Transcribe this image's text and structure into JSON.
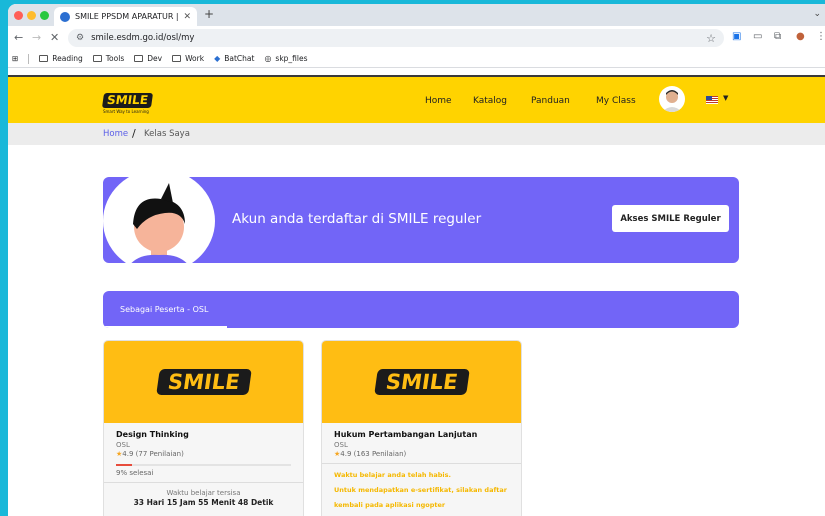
{
  "browser": {
    "tab_title": "SMILE PPSDM APARATUR | M",
    "url": "smile.esdm.go.id/osl/my",
    "bookmarks": [
      "Reading",
      "Tools",
      "Dev",
      "Work",
      "BatChat",
      "skp_files"
    ]
  },
  "header": {
    "logo_text": "SMILE",
    "logo_tagline": "Smart Way to Learning",
    "menu": [
      "Home",
      "Katalog",
      "Panduan",
      "My Class"
    ]
  },
  "breadcrumb": {
    "home": "Home",
    "separator": "/",
    "current": "Kelas Saya"
  },
  "banner": {
    "message": "Akun anda terdaftar di SMILE reguler",
    "button": "Akses SMILE Reguler"
  },
  "section": {
    "label": "Sebagai Peserta - OSL"
  },
  "cards": [
    {
      "logo_text": "SMILE",
      "title": "Design Thinking",
      "subtitle": "OSL",
      "rating": "4.9 (77 Penilaian)",
      "progress": 0.09,
      "progress_text": "9% selesai",
      "time_label": "Waktu belajar tersisa",
      "time_value": "33 Hari 15 Jam 55 Menit 48 Detik"
    },
    {
      "logo_text": "SMILE",
      "title": "Hukum Pertambangan Lanjutan",
      "subtitle": "OSL",
      "rating": "4.9 (163 Penilaian)",
      "warning_1": "Waktu belajar anda telah habis.",
      "warning_2": "Untuk mendapatkan e-sertifikat, silakan daftar",
      "warning_3": "kembali pada aplikasi ngopter"
    }
  ],
  "colors": {
    "brand_yellow": "#ffd300",
    "card_yellow": "#ffbd13",
    "purple": "#7265f7",
    "link": "#5b5fe8"
  }
}
